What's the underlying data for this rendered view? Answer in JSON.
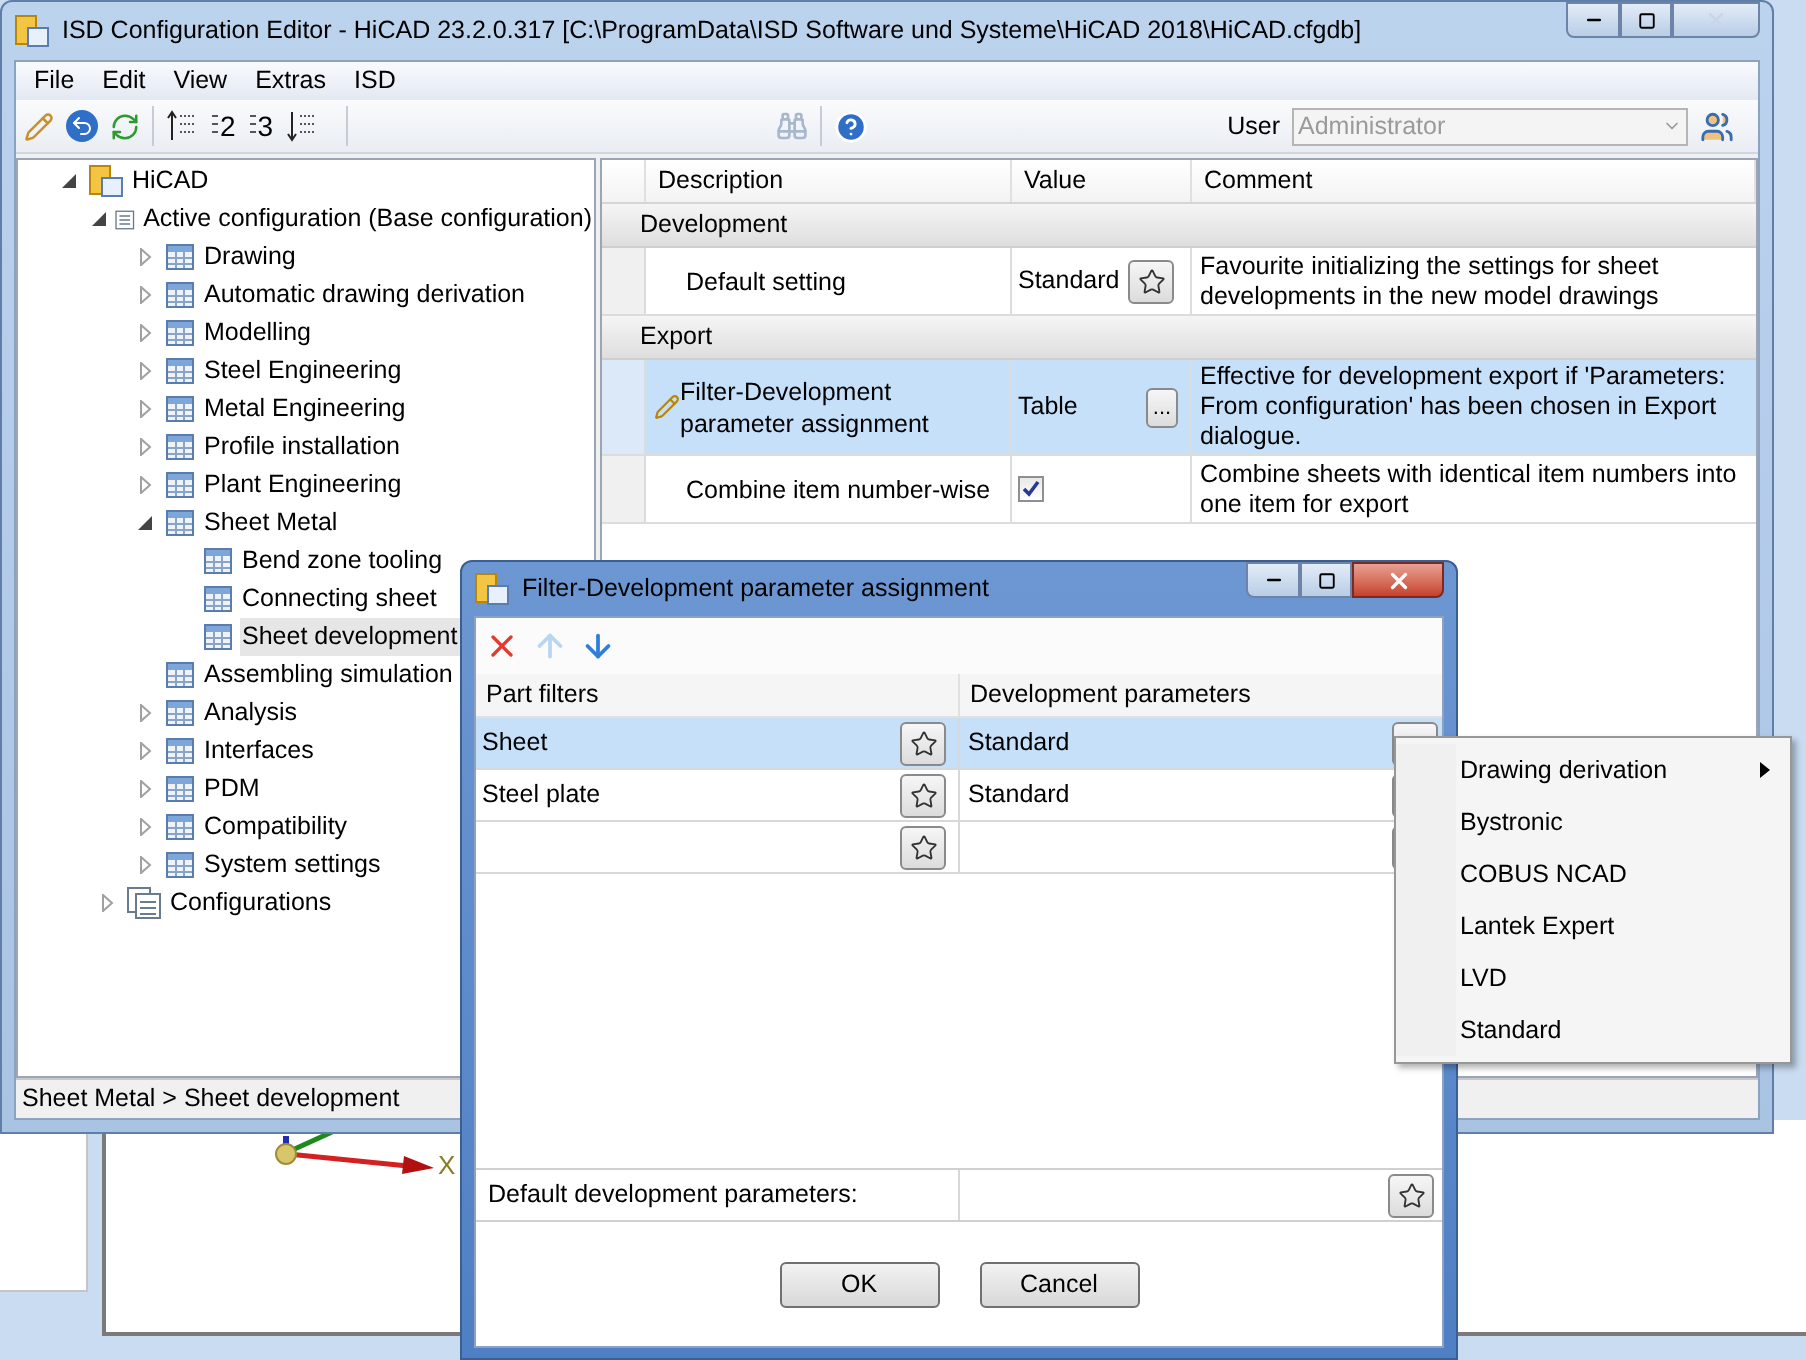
{
  "window": {
    "title": "ISD Configuration Editor  - HiCAD 23.2.0.317 [C:\\ProgramData\\ISD Software und Systeme\\HiCAD 2018\\HiCAD.cfgdb]"
  },
  "menu": [
    "File",
    "Edit",
    "View",
    "Extras",
    "ISD"
  ],
  "toolbar": {
    "level_labels": [
      "2",
      "3"
    ],
    "user_label": "User",
    "user_field": {
      "value": "Administrator",
      "disabled": true
    }
  },
  "tree": [
    {
      "label": "HiCAD",
      "kind": "root",
      "expanded": true,
      "selected": false,
      "children": [
        {
          "label": "Active configuration (Base configuration)",
          "kind": "list",
          "expanded": true,
          "selected": false,
          "children": [
            {
              "label": "Drawing",
              "kind": "table",
              "expanded": false,
              "selected": false
            },
            {
              "label": "Automatic drawing derivation",
              "kind": "table",
              "expanded": false,
              "selected": false
            },
            {
              "label": "Modelling",
              "kind": "table",
              "expanded": false,
              "selected": false
            },
            {
              "label": "Steel Engineering",
              "kind": "table",
              "expanded": false,
              "selected": false
            },
            {
              "label": "Metal Engineering",
              "kind": "table",
              "expanded": false,
              "selected": false
            },
            {
              "label": "Profile installation",
              "kind": "table",
              "expanded": false,
              "selected": false
            },
            {
              "label": "Plant Engineering",
              "kind": "table",
              "expanded": false,
              "selected": false
            },
            {
              "label": "Sheet Metal",
              "kind": "table",
              "expanded": true,
              "selected": false,
              "children": [
                {
                  "label": "Bend zone tooling",
                  "kind": "table",
                  "selected": false
                },
                {
                  "label": "Connecting sheet",
                  "kind": "table",
                  "selected": false
                },
                {
                  "label": "Sheet development",
                  "kind": "table",
                  "selected": true
                }
              ]
            },
            {
              "label": "Assembling simulation",
              "kind": "table",
              "selected": false
            },
            {
              "label": "Analysis",
              "kind": "table",
              "expanded": false,
              "selected": false
            },
            {
              "label": "Interfaces",
              "kind": "table",
              "expanded": false,
              "selected": false
            },
            {
              "label": "PDM",
              "kind": "table",
              "expanded": false,
              "selected": false
            },
            {
              "label": "Compatibility",
              "kind": "table",
              "expanded": false,
              "selected": false
            },
            {
              "label": "System settings",
              "kind": "table",
              "expanded": false,
              "selected": false
            }
          ]
        },
        {
          "label": "Configurations",
          "kind": "configs",
          "expanded": false,
          "selected": false
        }
      ]
    }
  ],
  "status_bar": "Sheet Metal > Sheet development",
  "table": {
    "columns": [
      "Description",
      "Value",
      "Comment"
    ],
    "groups": [
      {
        "title": "Development",
        "rows": [
          {
            "description": "Default setting",
            "kind": "favourite",
            "value": "Standard",
            "comment": "Favourite initializing the settings for sheet developments in the new model drawings",
            "selected": false,
            "editing": false
          }
        ]
      },
      {
        "title": "Export",
        "rows": [
          {
            "description": "Filter-Development parameter assignment",
            "kind": "ellipsis",
            "value": "Table",
            "button": "...",
            "comment": "Effective for development export if 'Parameters: From configuration' has been chosen in Export dialogue.",
            "selected": true,
            "editing": true
          },
          {
            "description": "Combine item number-wise",
            "kind": "checkbox",
            "checked": true,
            "comment": "Combine sheets with identical item numbers into one item for export",
            "selected": false,
            "editing": false
          }
        ]
      }
    ]
  },
  "viewport": {
    "axis_label": "X"
  },
  "dialog": {
    "title": "Filter-Development parameter assignment",
    "columns": [
      "Part filters",
      "Development parameters"
    ],
    "rows": [
      {
        "part_filter": "Sheet",
        "parameter": "Standard",
        "selected": true
      },
      {
        "part_filter": "Steel plate",
        "parameter": "Standard",
        "selected": false
      },
      {
        "selected": false
      }
    ],
    "default_label": "Default development parameters:",
    "buttons": [
      "OK",
      "Cancel"
    ]
  },
  "context_menu": [
    {
      "label": "Drawing derivation",
      "submenu": true
    },
    {
      "label": "Bystronic",
      "submenu": false
    },
    {
      "label": "COBUS NCAD",
      "submenu": false
    },
    {
      "label": "Lantek Expert",
      "submenu": false
    },
    {
      "label": "LVD",
      "submenu": false
    },
    {
      "label": "Standard",
      "submenu": false
    }
  ]
}
